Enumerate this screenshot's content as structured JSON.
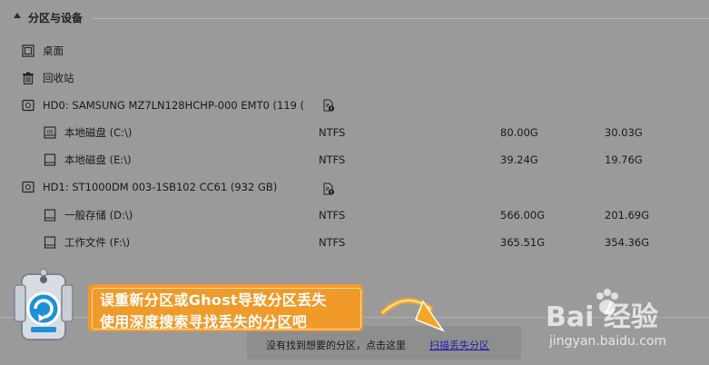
{
  "section": {
    "title": "分区与设备"
  },
  "items": [
    {
      "label": "桌面",
      "icon": "desktop-icon"
    },
    {
      "label": "回收站",
      "icon": "trash-icon"
    }
  ],
  "disks": [
    {
      "label": "HD0: SAMSUNG MZ7LN128HCHP-000 EMT0 (119 (",
      "icon": "hard-disk-icon"
    },
    {
      "label": "HD1: ST1000DM 003-1SB102 CC61 (932 GB)",
      "icon": "hard-disk-icon"
    }
  ],
  "partitions": [
    {
      "label": "本地磁盘 (C:\\)",
      "fs": "NTFS",
      "size": "80.00G",
      "free": "30.03G",
      "icon": "os-drive-icon"
    },
    {
      "label": "本地磁盘 (E:\\)",
      "fs": "NTFS",
      "size": "39.24G",
      "free": "19.76G",
      "icon": "drive-icon"
    },
    {
      "label": "一般存储 (D:\\)",
      "fs": "NTFS",
      "size": "566.00G",
      "free": "201.69G",
      "icon": "drive-icon"
    },
    {
      "label": "工作文件 (F:\\)",
      "fs": "NTFS",
      "size": "365.51G",
      "free": "354.36G",
      "icon": "drive-icon"
    }
  ],
  "bottom": {
    "prompt": "没有找到想要的分区，点击这里",
    "link": "扫描丢失分区"
  },
  "callout": {
    "line1": "误重新分区或Ghost导致分区丢失",
    "line2": "使用深度搜索寻找丢失的分区吧"
  },
  "watermark": {
    "brand": "Bai 经验",
    "url": "jingyan.baidu.com"
  },
  "colors": {
    "background": "#9a9a9a",
    "callout": "#f09a2a",
    "link": "#2222aa",
    "arrow": "#f5a623"
  }
}
